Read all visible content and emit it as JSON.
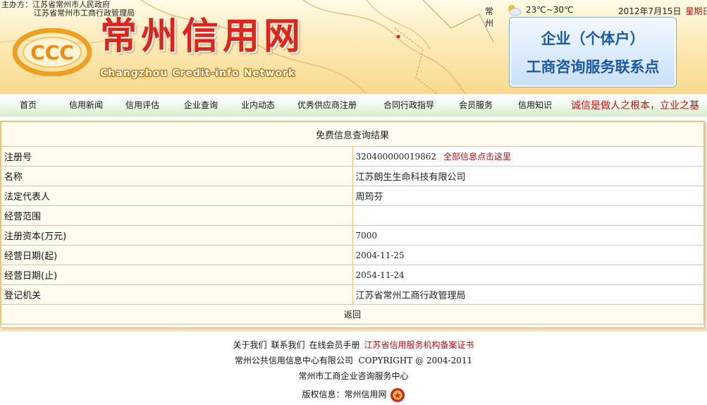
{
  "header": {
    "sponsor_label": "主办方：",
    "sponsor_1": "江苏省常州市人民政府",
    "sponsor_2": "江苏省常州市工商行政管理局",
    "logo_mark": "CCC",
    "site_name_cn": "常州信用网",
    "site_name_en": "Changzhou Credit-info Network",
    "weather": {
      "city": "常州",
      "icon": "partly-cloudy-icon",
      "temp": "23℃~30℃"
    },
    "date": "2012年7月15日",
    "weekday": "星期日",
    "promo_line1": "企业（个体户）",
    "promo_line2": "工商咨询服务联系点"
  },
  "nav": {
    "items": [
      "首页",
      "信用新闻",
      "信用评估",
      "企业查询",
      "业内动态",
      "优秀供应商注册",
      "合同行政指导",
      "会员服务",
      "信用知识"
    ],
    "slogan": "诚信是做人之根本，立业之基"
  },
  "result": {
    "title": "免费信息查询结果",
    "show_all_link": "全部信息点击这里",
    "rows": [
      {
        "label": "注册号",
        "value": "320400000019862"
      },
      {
        "label": "名称",
        "value": "江苏朗生生命科技有限公司"
      },
      {
        "label": "法定代表人",
        "value": "周筠芬"
      },
      {
        "label": "经营范围",
        "value": ""
      },
      {
        "label": "注册资本(万元)",
        "value": "7000"
      },
      {
        "label": "经营日期(起)",
        "value": "2004-11-25"
      },
      {
        "label": "经营日期(止)",
        "value": "2054-11-24"
      },
      {
        "label": "登记机关",
        "value": "江苏省常州工商行政管理局"
      }
    ],
    "back_label": "返回"
  },
  "footer": {
    "links": [
      "关于我们",
      "联系我们",
      "在线会员手册",
      "江苏省信用服务机构备案证书"
    ],
    "company": "常州公共信用信息中心有限公司",
    "copyright": "COPYRIGHT @ 2004-2011",
    "center": "常州市工商企业咨询服务中心",
    "rights_label": "版权信息：常州信用网",
    "badge_icon": "police-badge-icon"
  },
  "colors": {
    "accent_red": "#e0241c",
    "link_red": "#b01010",
    "promo_blue": "#1d5aa6",
    "table_border": "#e8c679"
  }
}
